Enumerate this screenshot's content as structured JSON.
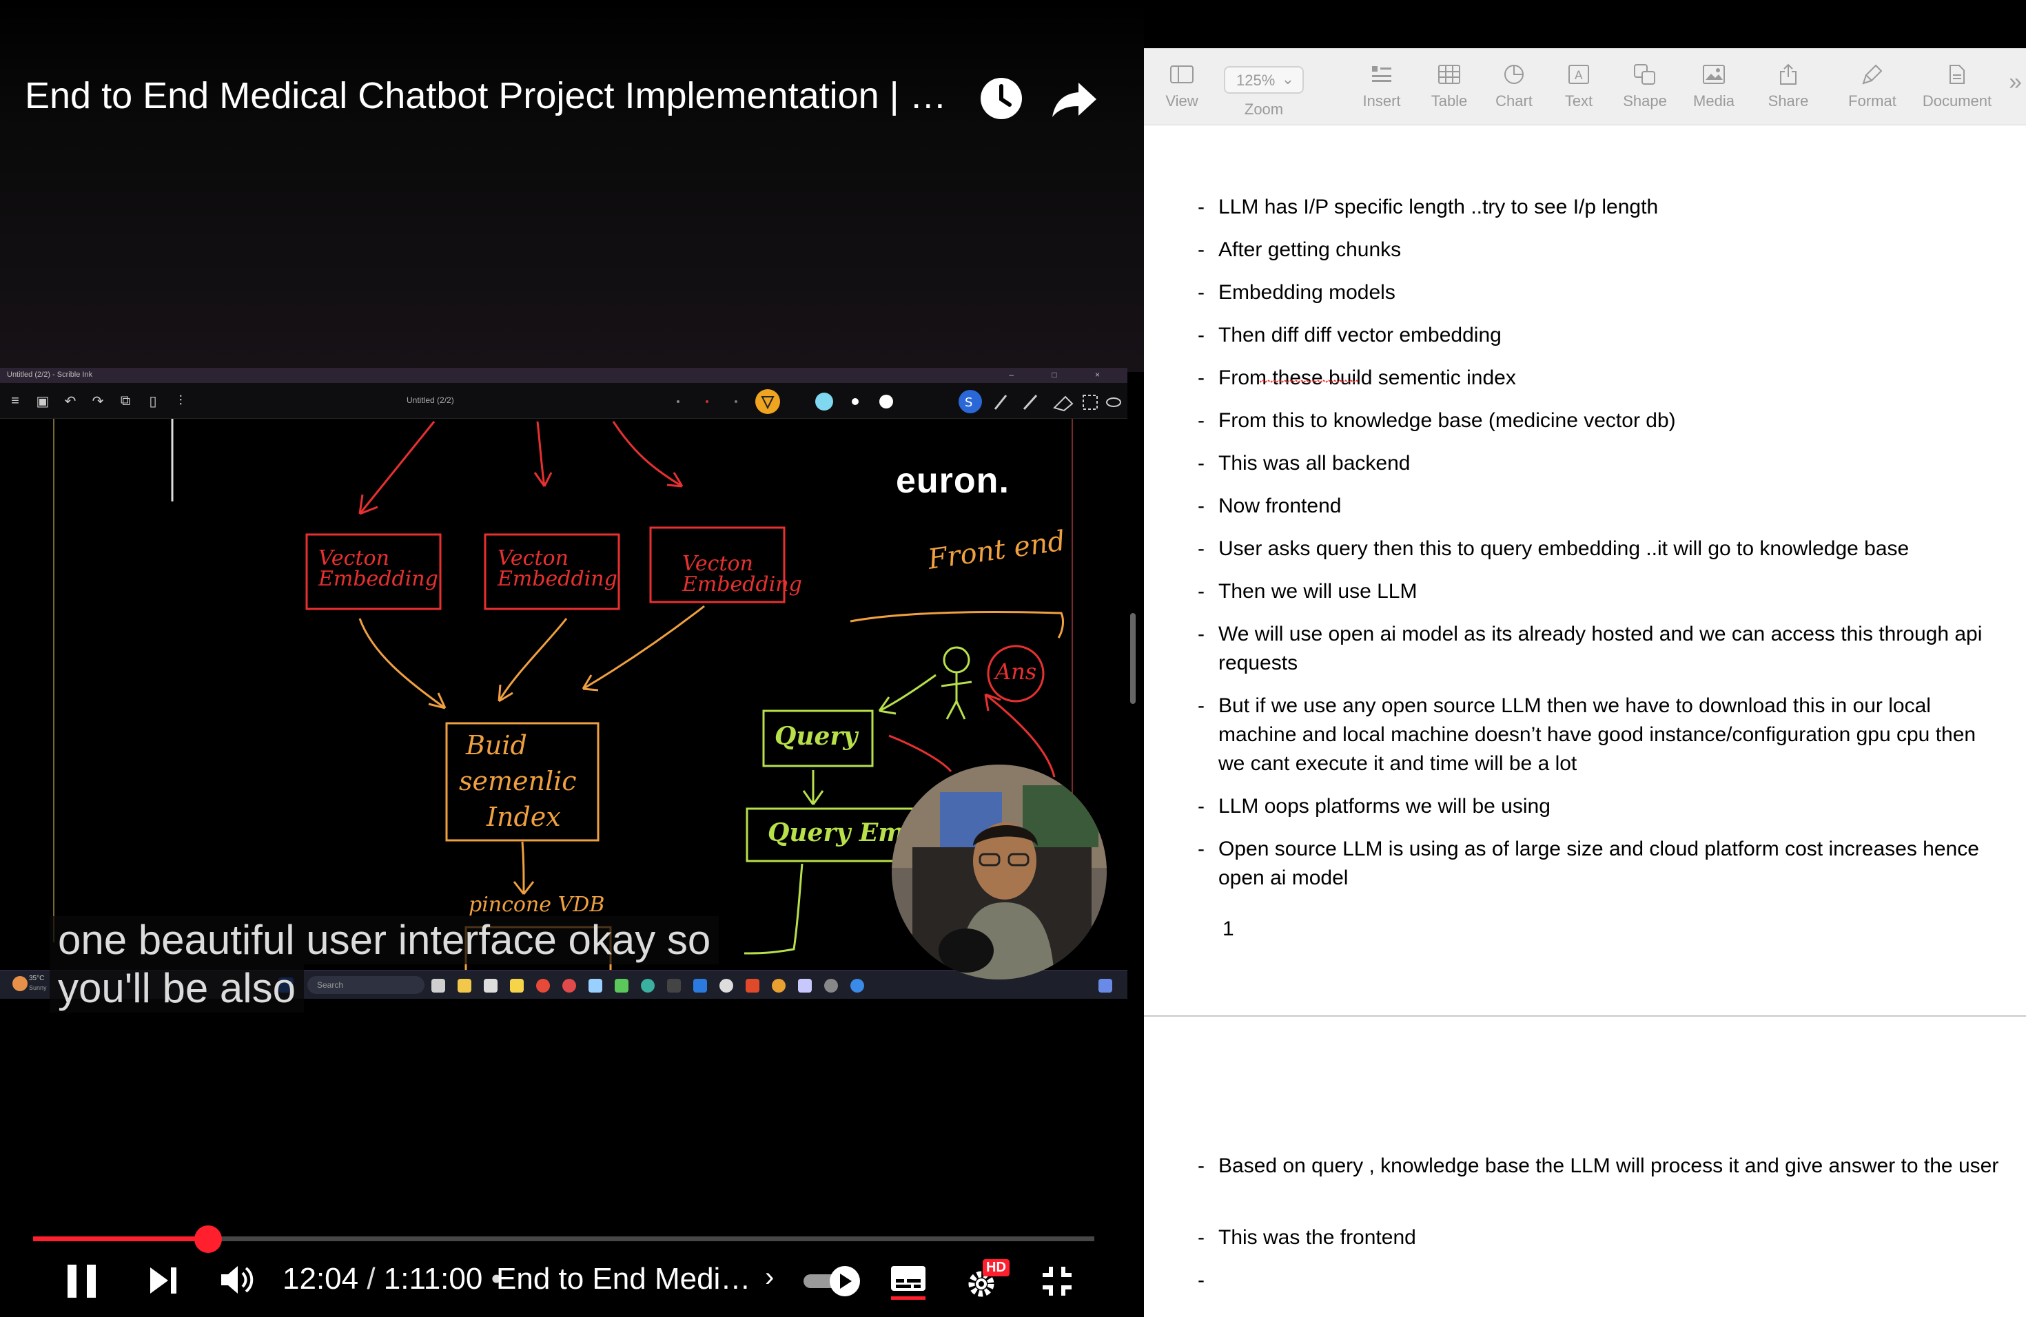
{
  "video": {
    "title": "End to End Medical Chatbot Project Implementation | G...",
    "screen_app_title": "Untitled (2/2) - Scrible Ink",
    "screen_doc_title": "Untitled (2/2)",
    "logo": "euron.",
    "whiteboard": {
      "boxes": [
        "Vecton Embedding",
        "Vecton Embedding",
        "Vecton Embedding"
      ],
      "build_index": [
        "Buid",
        "semenlic",
        "Index"
      ],
      "pinecone": "pincone VDB",
      "front_end": "Front end",
      "query": "Query",
      "query_emb": "Query Em",
      "ans": "Ans"
    },
    "taskbar": {
      "search": "Search",
      "weather": "35°C",
      "weather_sub": "Sunny"
    },
    "caption": {
      "line1": "one beautiful user interface okay so",
      "line2": "you'll be also"
    },
    "time_current": "12:04",
    "time_sep": " / ",
    "time_total": "1:11:00",
    "chapter_sep": " • ",
    "chapter_title": "End to End Medical ...",
    "chapter_chevron": "›",
    "progress": 0.165,
    "hd_badge": "HD",
    "accent": "#ff1f2d"
  },
  "pages": {
    "toolbar": {
      "view": "View",
      "zoom_value": "125%",
      "zoom": "Zoom",
      "insert": "Insert",
      "table": "Table",
      "chart": "Chart",
      "text": "Text",
      "shape": "Shape",
      "media": "Media",
      "share": "Share",
      "format": "Format",
      "document": "Document"
    },
    "bullets": [
      {
        "dash": "-",
        "text": "LLM has I/P specific length ..try to see I/p length"
      },
      {
        "dash": "-",
        "text": "After getting chunks"
      },
      {
        "dash": "-",
        "text": "Embedding models"
      },
      {
        "dash": "-",
        "text": "Then diff diff vector embedding"
      },
      {
        "dash": "-",
        "text": "From these build semantic index",
        "display": "From these build sementic index"
      },
      {
        "dash": "-",
        "text": "From this to knowledge base (medicine vector db)"
      },
      {
        "dash": "-",
        "text": "This was all backend"
      },
      {
        "dash": "-",
        "text": "Now frontend"
      },
      {
        "dash": "-",
        "text": "User asks query then this to query embedding ..it will go to knowledge base"
      },
      {
        "dash": "-",
        "text": "Then we will use LLM"
      },
      {
        "dash": "-",
        "text": "We will use open ai model as its already hosted and we can access this through api requests"
      },
      {
        "dash": "-",
        "text": "But if we use any open source LLM then we have to download this in our local machine and local machine doesn’t have good instance/configuration gpu cpu then we cant execute  it and time will be a lot"
      },
      {
        "dash": "-",
        "text": "LLM oops platforms we will be using"
      },
      {
        "dash": "-",
        "text": "Open source LLM is using as of large size and cloud platform cost increases hence open ai model"
      }
    ],
    "page_number": "1",
    "page2_bullets": [
      {
        "dash": "-",
        "text": "Based on query , knowledge base the LLM will process it and give answer to the user"
      },
      {
        "dash": "-",
        "text": "This was the frontend"
      },
      {
        "dash": "-",
        "text": ""
      }
    ]
  }
}
